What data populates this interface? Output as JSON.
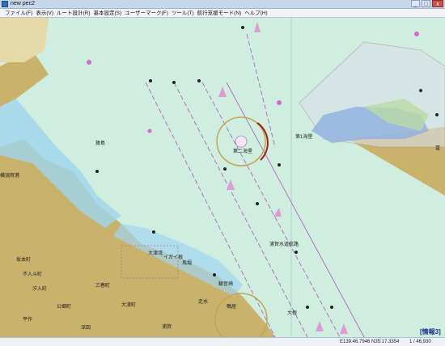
{
  "window": {
    "title": "new pec2",
    "minimize_label": "_",
    "maximize_label": "□",
    "close_label": "x"
  },
  "menu": [
    {
      "label": "ファイル(F)"
    },
    {
      "label": "表示(V)"
    },
    {
      "label": "ルート設計(R)"
    },
    {
      "label": "基本設定(S)"
    },
    {
      "label": "ユーザーマーク(F)"
    },
    {
      "label": "ツール(T)"
    },
    {
      "label": "航行支援モード(N)"
    },
    {
      "label": "ヘルプ(H)"
    }
  ],
  "map_labels": {
    "station1": "第1海堡",
    "station2": "第二海堡",
    "channel": "浦賀水道航路",
    "otsu_bay": "大津湾",
    "town_ohtsu": "大津町",
    "town_baba": "馬堀",
    "town_sarushima": "猿島",
    "town_ikarashi": "イガイ根",
    "town_kannon": "観音崎",
    "town_taketa": "大根",
    "town_sakamoto": "坂本町",
    "town_ichi": "不入斗町",
    "town_minami": "汐入町",
    "town_hirasaku": "平作",
    "town_kobu": "公郷町",
    "town_uraga": "浦賀",
    "town_kanaya": "三春町",
    "town_fukai": "深田",
    "town_sao": "走水",
    "town_kamo": "鴨居",
    "town_fuka": "富",
    "town_yokosuka": "横須賀港"
  },
  "status": {
    "coordinates": "E139:46.7946 N35:17.3354",
    "scale": "1 / 46,930",
    "info_badge": "[情報3]"
  },
  "colors": {
    "sea": "#cfeee0",
    "land": "#c9b26c",
    "shallow": "#9fd4ee",
    "route_line": "#b055b8",
    "title_bar": "#c8d6ea"
  }
}
